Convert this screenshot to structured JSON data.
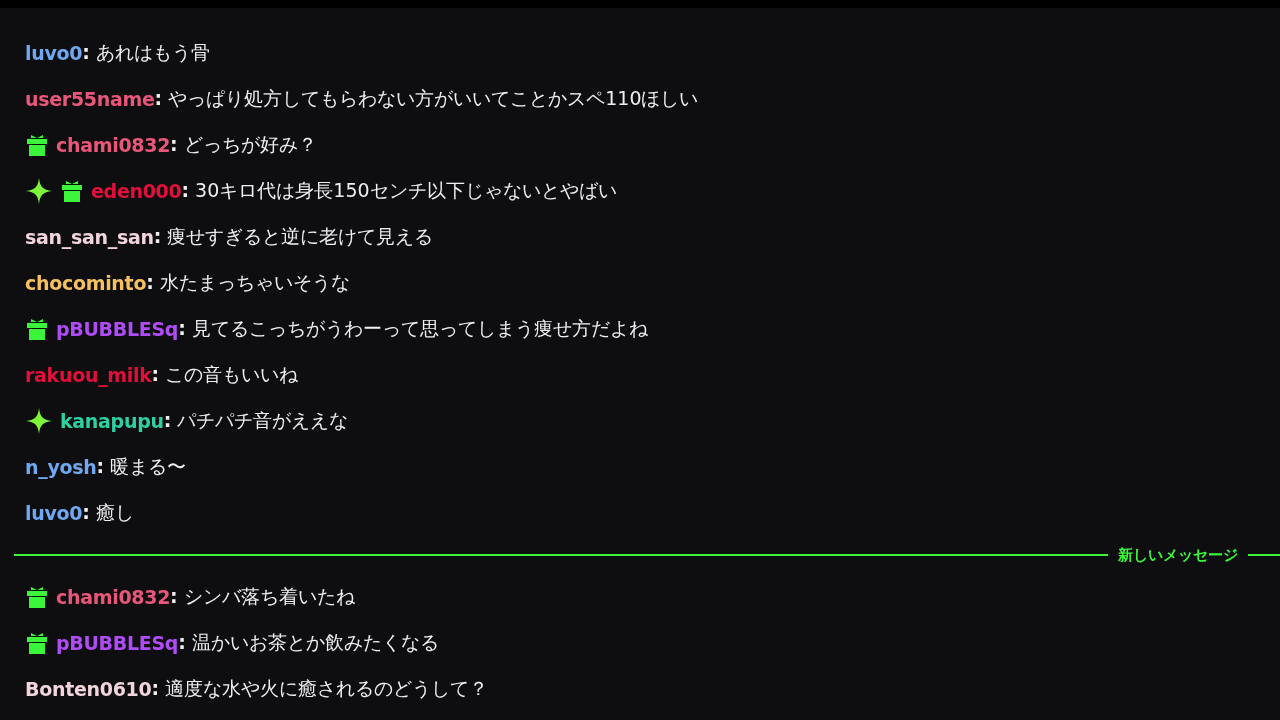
{
  "messages_before": [
    {
      "user": "luvo0",
      "color": "#6fa8f0",
      "text": "**:** あれはもう骨"
    },
    {
      "user": "user55name",
      "color": "#e8577a",
      "text": "**:** やっぱり処方してもらわない方がいいてことかスペ110ほしい"
    },
    {
      "badges": [
        {
          "kind": "gift"
        }
      ],
      "user": "chami0832",
      "color": "#e8577a",
      "text": "**:** どっちが好み？"
    },
    {
      "badges": [
        {
          "kind": "sparkle"
        },
        {
          "kind": "gift"
        }
      ],
      "user": "eden000",
      "color": "#e0103a",
      "text": "**:** 30キロ代は身長150センチ以下じゃないとやばい"
    },
    {
      "user": "san_san_san",
      "color": "#f2d4dc",
      "text": "**:** 痩せすぎると逆に老けて見える"
    },
    {
      "user": "chocominto",
      "color": "#f5c060",
      "text": "**:** 水たまっちゃいそうな"
    },
    {
      "badges": [
        {
          "kind": "gift"
        }
      ],
      "user": "pBUBBLESq",
      "color": "#b04cf5",
      "text": "**:** 見てるこっちがうわーって思ってしまう痩せ方だよね"
    },
    {
      "user": "rakuou_milk",
      "color": "#e0103a",
      "text": "**:** この音もいいね"
    },
    {
      "badges": [
        {
          "kind": "sparkle"
        }
      ],
      "user": "kanapupu",
      "color": "#2fd0a0",
      "text": "**:** パチパチ音がええな"
    },
    {
      "user": "n_yosh",
      "color": "#6fa8f0",
      "text": "**:** 暖まる〜"
    },
    {
      "user": "luvo0",
      "color": "#6fa8f0",
      "text": "**:** 癒し"
    }
  ],
  "divider": {
    "label": "新しいメッセージ"
  },
  "messages_after": [
    {
      "badges": [
        {
          "kind": "gift"
        }
      ],
      "user": "chami0832",
      "color": "#e8577a",
      "text": "**:** シンバ落ち着いたね"
    },
    {
      "badges": [
        {
          "kind": "gift"
        }
      ],
      "user": "pBUBBLESq",
      "color": "#b04cf5",
      "text": "**:** 温かいお茶とか飲みたくなる"
    },
    {
      "user": "Bonten0610",
      "color": "#f2d4dc",
      "text": "**:** 適度な水や火に癒されるのどうして？"
    }
  ]
}
